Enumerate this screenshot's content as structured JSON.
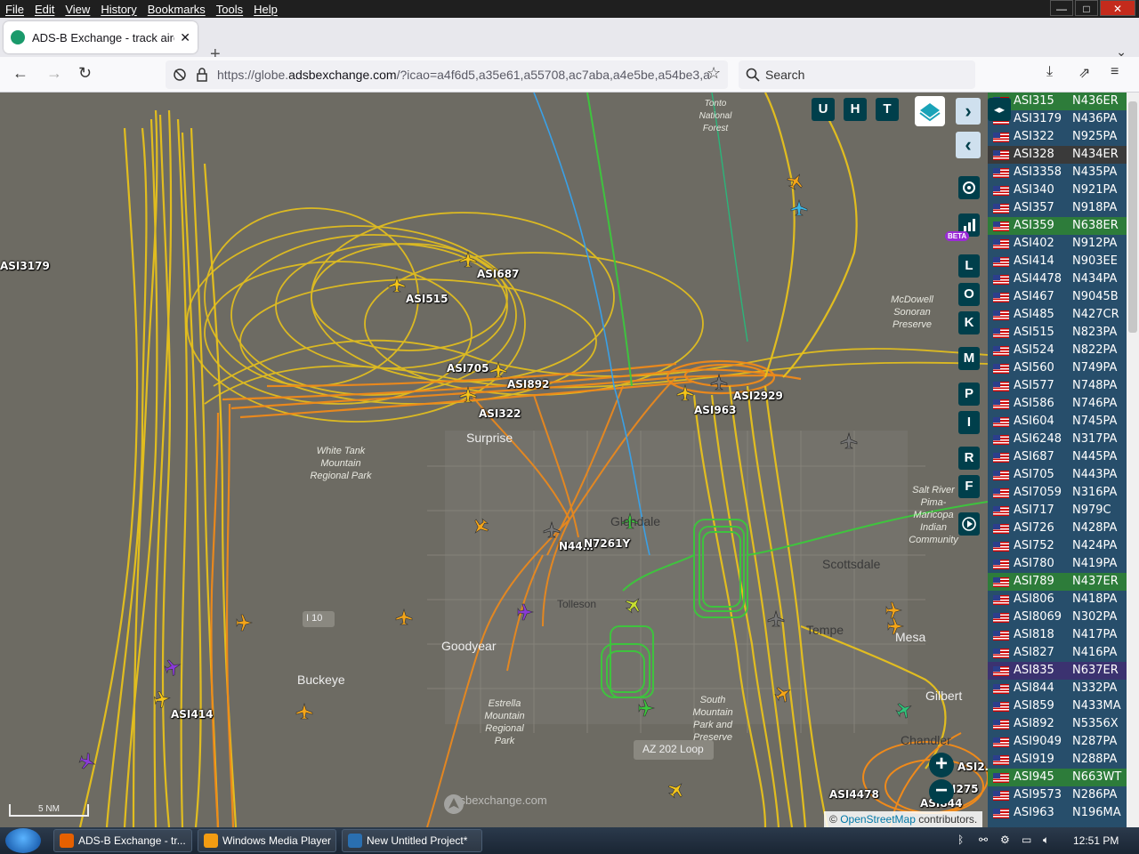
{
  "menu": [
    "File",
    "Edit",
    "View",
    "History",
    "Bookmarks",
    "Tools",
    "Help"
  ],
  "window_controls": {
    "minimize": "—",
    "maximize": "□",
    "close": "✕"
  },
  "tab": {
    "title": "ADS-B Exchange - track aircraft",
    "close": "✕",
    "new": "+",
    "list": "⌄"
  },
  "nav": {
    "back": "←",
    "forward": "→",
    "reload": "↻",
    "url_prefix": "https://globe.",
    "url_domain": "adsbexchange.com",
    "url_rest": "/?icao=a4f6d5,a35e61,a55708,ac7aba,a4e5be,a54be3,a",
    "search": "Search"
  },
  "map": {
    "aircraft_labels": [
      "ASI3179",
      "ASI687",
      "ASI515",
      "ASI705",
      "ASI892",
      "ASI322",
      "ASI2929",
      "ASI963",
      "N44…",
      "N7261Y",
      "ASI414",
      "ASI4478",
      "ASI2…",
      "ASI844",
      "I275"
    ],
    "places": [
      "Surprise",
      "Goodyear",
      "Buckeye",
      "Tolleson",
      "Glendale",
      "Scottsdale",
      "Tempe",
      "Mesa",
      "Gilbert",
      "Chandler",
      "I 10",
      "AZ 202 Loop"
    ],
    "parks": [
      "White Tank Mountain Regional Park",
      "Estrella Mountain Regional Park",
      "South Mountain Park and Preserve",
      "McDowell Sonoran Preserve",
      "Salt River Pima-Maricopa Indian Community",
      "Tonto National Forest"
    ],
    "toolbar": [
      "U",
      "H",
      "T"
    ],
    "side_buttons": [
      "L",
      "O",
      "K",
      "M",
      "P",
      "I",
      "R",
      "F"
    ],
    "beta": "BETA",
    "scale": "5 NM",
    "watermark": "adsbexchange.com",
    "attribution_link": "OpenStreetMap",
    "attribution_rest": " contributors.",
    "zoom_in": "+",
    "zoom_out": "−"
  },
  "aircraft_list": [
    {
      "callsign": "ASI315",
      "reg": "N436ER",
      "bg": "#2d7c3a"
    },
    {
      "callsign": "ASI3179",
      "reg": "N436PA",
      "bg": "#274e6b"
    },
    {
      "callsign": "ASI322",
      "reg": "N925PA",
      "bg": "#274e6b"
    },
    {
      "callsign": "ASI328",
      "reg": "N434ER",
      "bg": "#3a3a3a"
    },
    {
      "callsign": "ASI3358",
      "reg": "N435PA",
      "bg": "#274e6b"
    },
    {
      "callsign": "ASI340",
      "reg": "N921PA",
      "bg": "#274e6b"
    },
    {
      "callsign": "ASI357",
      "reg": "N918PA",
      "bg": "#274e6b"
    },
    {
      "callsign": "ASI359",
      "reg": "N638ER",
      "bg": "#2d7c3a"
    },
    {
      "callsign": "ASI402",
      "reg": "N912PA",
      "bg": "#274e6b"
    },
    {
      "callsign": "ASI414",
      "reg": "N903EE",
      "bg": "#274e6b"
    },
    {
      "callsign": "ASI4478",
      "reg": "N434PA",
      "bg": "#274e6b"
    },
    {
      "callsign": "ASI467",
      "reg": "N9045B",
      "bg": "#274e6b"
    },
    {
      "callsign": "ASI485",
      "reg": "N427CR",
      "bg": "#274e6b"
    },
    {
      "callsign": "ASI515",
      "reg": "N823PA",
      "bg": "#274e6b"
    },
    {
      "callsign": "ASI524",
      "reg": "N822PA",
      "bg": "#274e6b"
    },
    {
      "callsign": "ASI560",
      "reg": "N749PA",
      "bg": "#274e6b"
    },
    {
      "callsign": "ASI577",
      "reg": "N748PA",
      "bg": "#274e6b"
    },
    {
      "callsign": "ASI586",
      "reg": "N746PA",
      "bg": "#274e6b"
    },
    {
      "callsign": "ASI604",
      "reg": "N745PA",
      "bg": "#274e6b"
    },
    {
      "callsign": "ASI6248",
      "reg": "N317PA",
      "bg": "#274e6b"
    },
    {
      "callsign": "ASI687",
      "reg": "N445PA",
      "bg": "#274e6b"
    },
    {
      "callsign": "ASI705",
      "reg": "N443PA",
      "bg": "#274e6b"
    },
    {
      "callsign": "ASI7059",
      "reg": "N316PA",
      "bg": "#274e6b"
    },
    {
      "callsign": "ASI717",
      "reg": "N979C",
      "bg": "#274e6b"
    },
    {
      "callsign": "ASI726",
      "reg": "N428PA",
      "bg": "#274e6b"
    },
    {
      "callsign": "ASI752",
      "reg": "N424PA",
      "bg": "#274e6b"
    },
    {
      "callsign": "ASI780",
      "reg": "N419PA",
      "bg": "#274e6b"
    },
    {
      "callsign": "ASI789",
      "reg": "N437ER",
      "bg": "#2d7c3a"
    },
    {
      "callsign": "ASI806",
      "reg": "N418PA",
      "bg": "#274e6b"
    },
    {
      "callsign": "ASI8069",
      "reg": "N302PA",
      "bg": "#274e6b"
    },
    {
      "callsign": "ASI818",
      "reg": "N417PA",
      "bg": "#274e6b"
    },
    {
      "callsign": "ASI827",
      "reg": "N416PA",
      "bg": "#274e6b"
    },
    {
      "callsign": "ASI835",
      "reg": "N637ER",
      "bg": "#3b3270"
    },
    {
      "callsign": "ASI844",
      "reg": "N332PA",
      "bg": "#274e6b"
    },
    {
      "callsign": "ASI859",
      "reg": "N433MA",
      "bg": "#274e6b"
    },
    {
      "callsign": "ASI892",
      "reg": "N5356X",
      "bg": "#274e6b"
    },
    {
      "callsign": "ASI9049",
      "reg": "N287PA",
      "bg": "#274e6b"
    },
    {
      "callsign": "ASI919",
      "reg": "N288PA",
      "bg": "#274e6b"
    },
    {
      "callsign": "ASI945",
      "reg": "N663WT",
      "bg": "#2d7c3a"
    },
    {
      "callsign": "ASI9573",
      "reg": "N286PA",
      "bg": "#274e6b"
    },
    {
      "callsign": "ASI963",
      "reg": "N196MA",
      "bg": "#274e6b"
    }
  ],
  "taskbar": {
    "tasks": [
      {
        "label": "ADS-B Exchange - tr...",
        "icon": "firefox-icon",
        "color": "#e66000"
      },
      {
        "label": "Windows Media Player",
        "icon": "media-player-icon",
        "color": "#f39c12"
      },
      {
        "label": "New Untitled Project*",
        "icon": "project-icon",
        "color": "#2a6fb0"
      }
    ],
    "time": "12:51 PM"
  },
  "colors": {
    "track_yellow": "#e8c21c",
    "track_orange": "#f08a1a",
    "track_green": "#3cc83c",
    "panel": "#274e6b",
    "button": "#003f4b"
  }
}
